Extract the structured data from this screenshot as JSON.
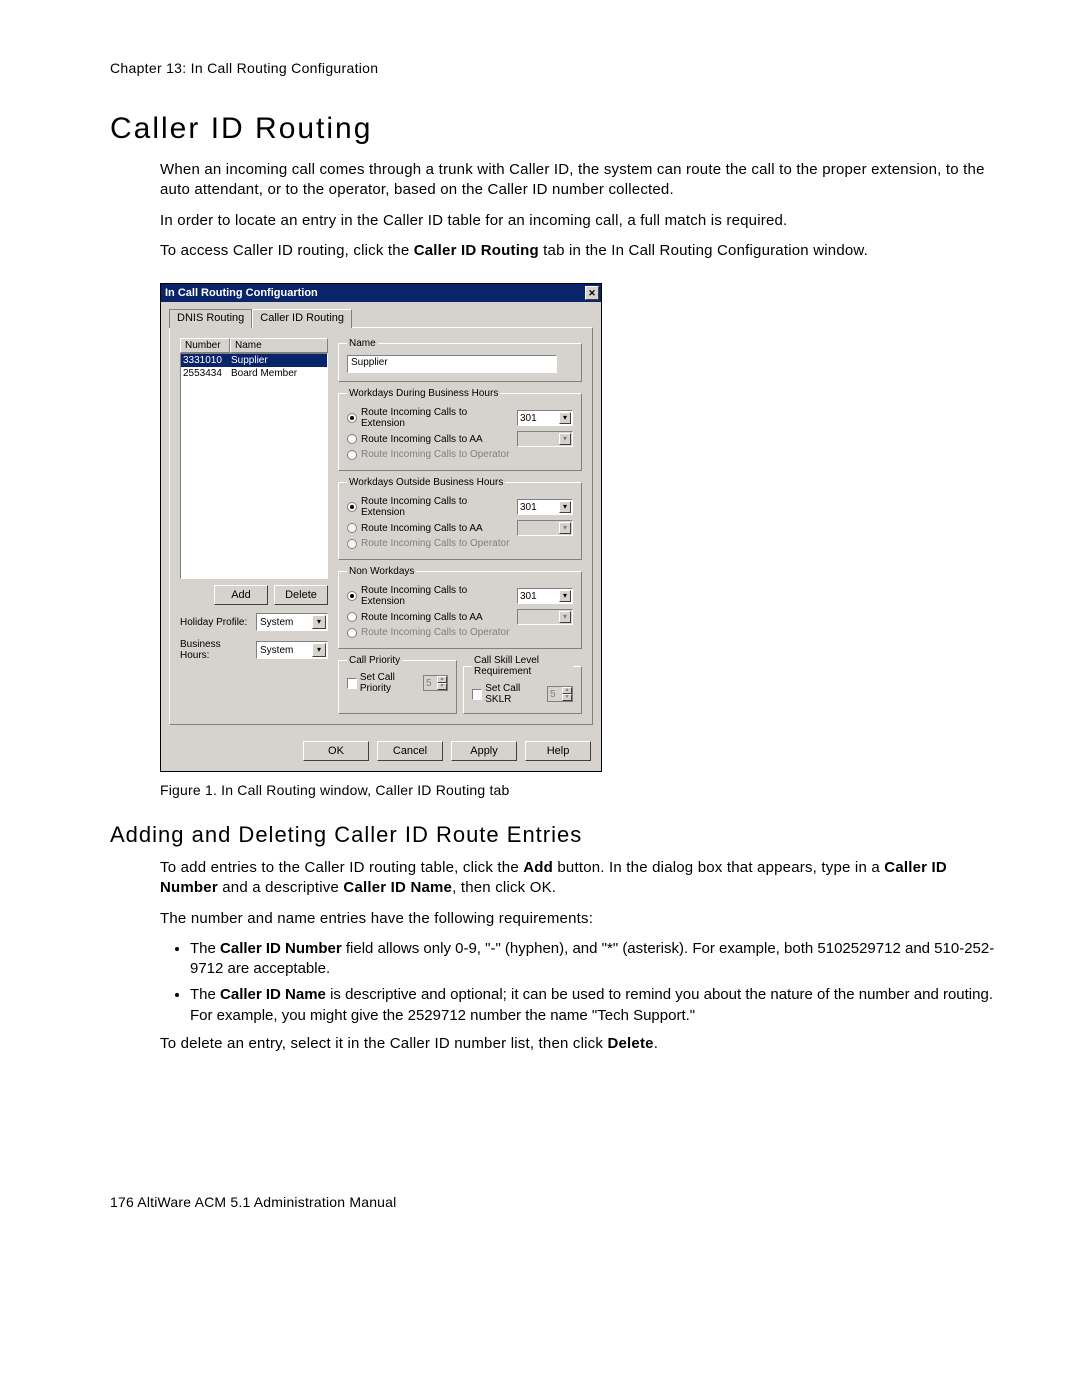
{
  "chapter_header": "Chapter 13:  In Call Routing Configuration",
  "section_title": "Caller ID Routing",
  "paragraphs": {
    "p1": "When an incoming call comes through a trunk with Caller ID, the system can route the call to the proper extension, to the auto attendant, or to the operator, based on the Caller ID number collected.",
    "p2": "In order to locate an entry in the Caller ID table for an incoming call, a full match is required.",
    "p3_pre": "To access Caller ID routing, click the ",
    "p3_bold": "Caller ID Routing",
    "p3_post": " tab in the In Call Routing Configuration window."
  },
  "figure_caption": "Figure 1.   In Call Routing window, Caller ID Routing tab",
  "subsection_title": "Adding and Deleting Caller ID Route Entries",
  "sub_paragraphs": {
    "s1_pre": "To add entries to the Caller ID routing table, click the ",
    "s1_b1": "Add",
    "s1_mid": " button. In the dialog box that appears, type in a ",
    "s1_b2": "Caller ID Number",
    "s1_mid2": " and a descriptive ",
    "s1_b3": "Caller ID Name",
    "s1_post": ", then click OK.",
    "s2": "The number and name entries have the following requirements:",
    "li1_pre": "The ",
    "li1_b": "Caller ID Number",
    "li1_post": " field allows only 0-9, \"-\" (hyphen), and \"*\" (asterisk). For example, both 5102529712 and 510-252-9712 are acceptable.",
    "li2_pre": "The ",
    "li2_b": "Caller ID Name",
    "li2_post": " is descriptive and optional; it can be used to remind you about the nature of the number and routing. For example, you might give the 2529712 number the name \"Tech Support.\"",
    "s3_pre": "To delete an entry, select it in the Caller ID number list, then click ",
    "s3_b": "Delete",
    "s3_post": "."
  },
  "footer": "176   AltiWare ACM 5.1 Administration Manual",
  "dialog": {
    "title": "In Call Routing Configuartion",
    "close_glyph": "✕",
    "tabs": {
      "t1": "DNIS Routing",
      "t2": "Caller ID Routing"
    },
    "list": {
      "h_number": "Number",
      "h_name": "Name",
      "rows": [
        {
          "num": "3331010",
          "name": "Supplier"
        },
        {
          "num": "2553434",
          "name": "Board Member"
        }
      ]
    },
    "buttons": {
      "add": "Add",
      "delete": "Delete",
      "ok": "OK",
      "cancel": "Cancel",
      "apply": "Apply",
      "help": "Help"
    },
    "profiles": {
      "holiday_label": "Holiday Profile:",
      "holiday_value": "System",
      "business_label": "Business Hours:",
      "business_value": "System"
    },
    "name_group": {
      "legend": "Name",
      "value": "Supplier"
    },
    "routing_groups": {
      "g1_legend": "Workdays During Business Hours",
      "g2_legend": "Workdays Outside Business Hours",
      "g3_legend": "Non Workdays",
      "opt_ext": "Route Incoming Calls to Extension",
      "opt_aa": "Route Incoming Calls to AA",
      "opt_op": "Route Incoming Calls to Operator",
      "ext_value": "301"
    },
    "priority": {
      "g_priority": "Call Priority",
      "g_sklr": "Call Skill Level Requirement",
      "chk_priority": "Set Call Priority",
      "chk_sklr": "Set Call SKLR",
      "spin_value": "5"
    },
    "chevron": "▾"
  }
}
